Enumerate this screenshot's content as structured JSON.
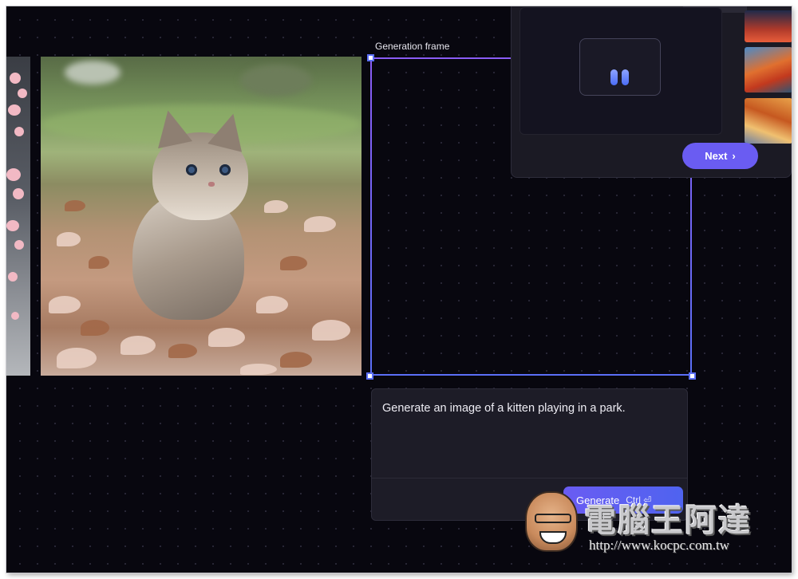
{
  "canvas": {
    "generation_frame_label": "Generation frame"
  },
  "prompt": {
    "text": "Generate an image of a kitten playing in a park.",
    "generate_label": "Generate",
    "shortcut_label": "Ctrl ⏎"
  },
  "side_panel": {
    "next_label": "Next",
    "next_chevron": "›"
  },
  "watermark": {
    "title": "電腦王阿達",
    "url": "http://www.kocpc.com.tw"
  },
  "colors": {
    "canvas_bg": "#08070f",
    "accent": "#6a5cf2",
    "frame_gradient_start": "#8a5cf5",
    "frame_gradient_end": "#5b6ff7"
  },
  "icons": {
    "loader": "loading-dots-icon",
    "chevron": "chevron-right-icon",
    "return": "return-key-icon"
  }
}
